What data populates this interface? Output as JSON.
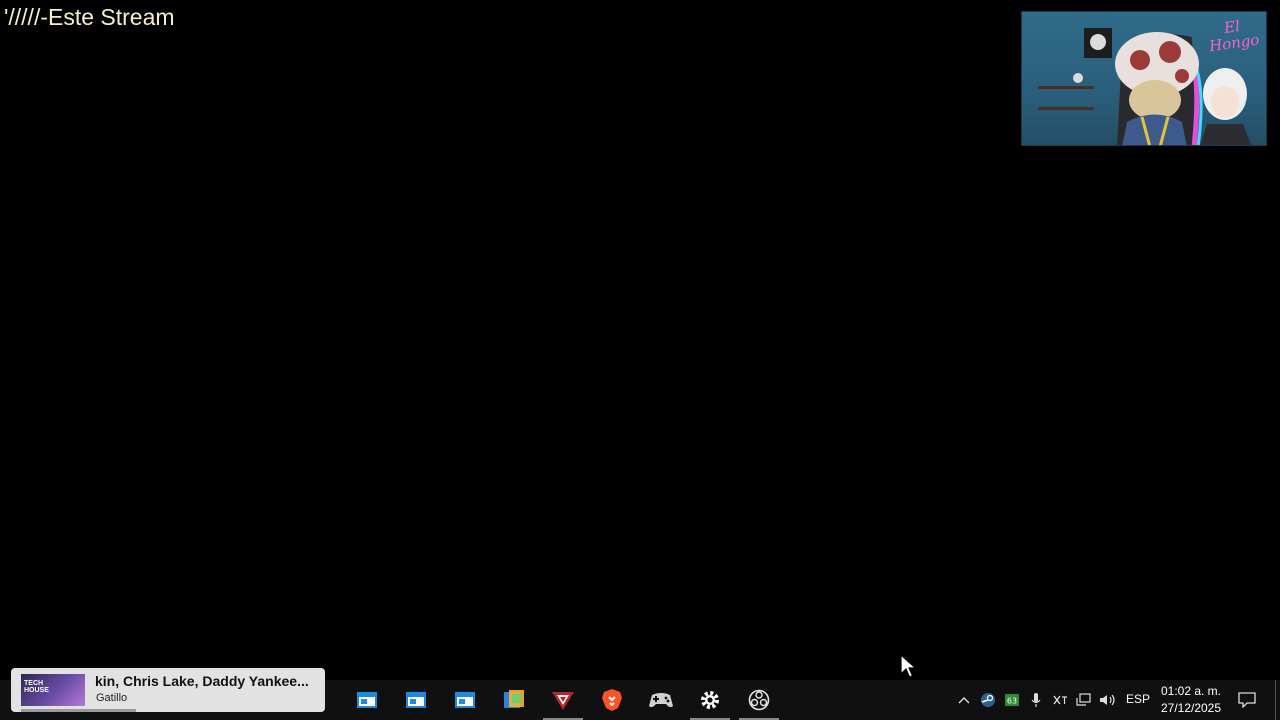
{
  "overlay": {
    "text": "'/////-Este Stream"
  },
  "webcam": {
    "logo_line1": "El",
    "logo_line2": "Hongo"
  },
  "media_player": {
    "thumb_label_line1": "TECH",
    "thumb_label_line2": "HOUSE",
    "title": "kin, Chris Lake, Daddy Yankee...",
    "artist": "Gatillo",
    "progress_fraction": 0.39
  },
  "taskbar": {
    "apps": [
      {
        "name": "file-explorer-window-icon",
        "active": false
      },
      {
        "name": "file-explorer-window-icon",
        "active": false
      },
      {
        "name": "file-explorer-window-icon",
        "active": false
      },
      {
        "name": "photo-app-icon",
        "active": false
      },
      {
        "name": "game-launcher-icon",
        "active": true
      },
      {
        "name": "brave-browser-icon",
        "active": false
      },
      {
        "name": "gamepad-icon",
        "active": false
      },
      {
        "name": "settings-gear-icon",
        "active": true
      },
      {
        "name": "obs-studio-icon",
        "active": true
      }
    ]
  },
  "tray": {
    "battery_badge": "63",
    "language": "ESP",
    "time": "01:02 a. m.",
    "date": "27/12/2025"
  },
  "colors": {
    "overlay_text": "#f5f0c8",
    "taskbar_bg": "#101010",
    "media_card_bg": "#ebebeb",
    "brave_orange": "#fb542b",
    "logo_pink": "#ff5fd1"
  }
}
